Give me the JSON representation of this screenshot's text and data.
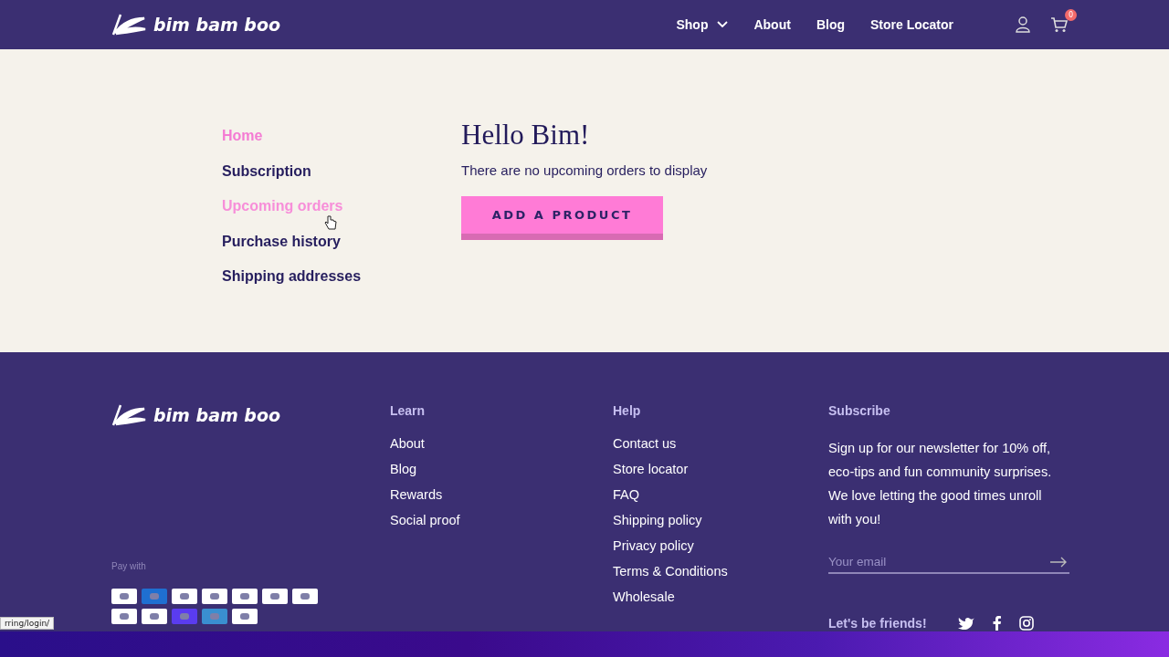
{
  "header": {
    "brand": "bim bam boo",
    "nav": [
      {
        "label": "Shop",
        "dropdown": true
      },
      {
        "label": "About",
        "dropdown": false
      },
      {
        "label": "Blog",
        "dropdown": false
      },
      {
        "label": "Store Locator",
        "dropdown": false
      }
    ],
    "cart_count": "0"
  },
  "account_menu": [
    {
      "label": "Home",
      "selected": true,
      "hovered": false
    },
    {
      "label": "Subscription",
      "selected": false,
      "hovered": false
    },
    {
      "label": "Upcoming orders",
      "selected": false,
      "hovered": true
    },
    {
      "label": "Purchase history",
      "selected": false,
      "hovered": false
    },
    {
      "label": "Shipping addresses",
      "selected": false,
      "hovered": false
    }
  ],
  "greeting": "Hello Bim!",
  "message": "There are no upcoming orders to display",
  "add_button": "ADD A PRODUCT",
  "footer": {
    "brand": "bim bam boo",
    "pay_label": "Pay with",
    "columns": [
      {
        "heading": "Learn",
        "links": [
          "About",
          "Blog",
          "Rewards",
          "Social proof"
        ]
      },
      {
        "heading": "Help",
        "links": [
          "Contact us",
          "Store locator",
          "FAQ",
          "Shipping policy",
          "Privacy policy",
          "Terms & Conditions",
          "Wholesale"
        ]
      }
    ],
    "subscribe": {
      "heading": "Subscribe",
      "text": "Sign up for our newsletter for 10% off, eco-tips and fun community surprises. We love letting the good times unroll with you!",
      "placeholder": "Your email",
      "social_label": "Let's be friends!"
    }
  },
  "status_url": "rring/login/"
}
